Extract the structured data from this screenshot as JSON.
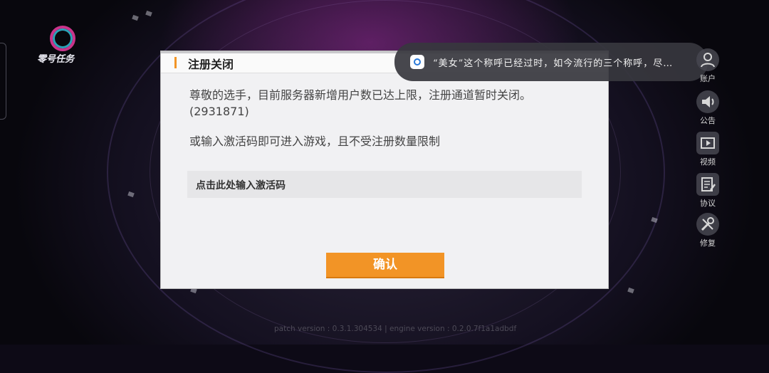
{
  "game": {
    "logo_text": "零号任务"
  },
  "dialog": {
    "title": "注册关闭",
    "message_line1": "尊敬的选手，目前服务器新增用户数已达上限，注册通道暂时关闭。",
    "message_line2": "(2931871)",
    "message_alt": "或输入激活码即可进入游戏，且不受注册数量限制",
    "code_placeholder": "点击此处输入激活码",
    "confirm_label": "确认"
  },
  "notification": {
    "text": "“美女”这个称呼已经过时，如今流行的三个称呼，尽…"
  },
  "sidebar": {
    "items": [
      {
        "label": "账户",
        "icon": "account-icon"
      },
      {
        "label": "公告",
        "icon": "speaker-icon"
      },
      {
        "label": "视频",
        "icon": "video-icon"
      },
      {
        "label": "协议",
        "icon": "agreement-icon"
      },
      {
        "label": "修复",
        "icon": "repair-icon"
      }
    ]
  },
  "footer": {
    "version_text": "patch version : 0.3.1.304534 | engine version : 0.2.0.7f1a1adbdf"
  },
  "colors": {
    "accent": "#f29426",
    "dialog_bg": "#f1f1f3"
  }
}
